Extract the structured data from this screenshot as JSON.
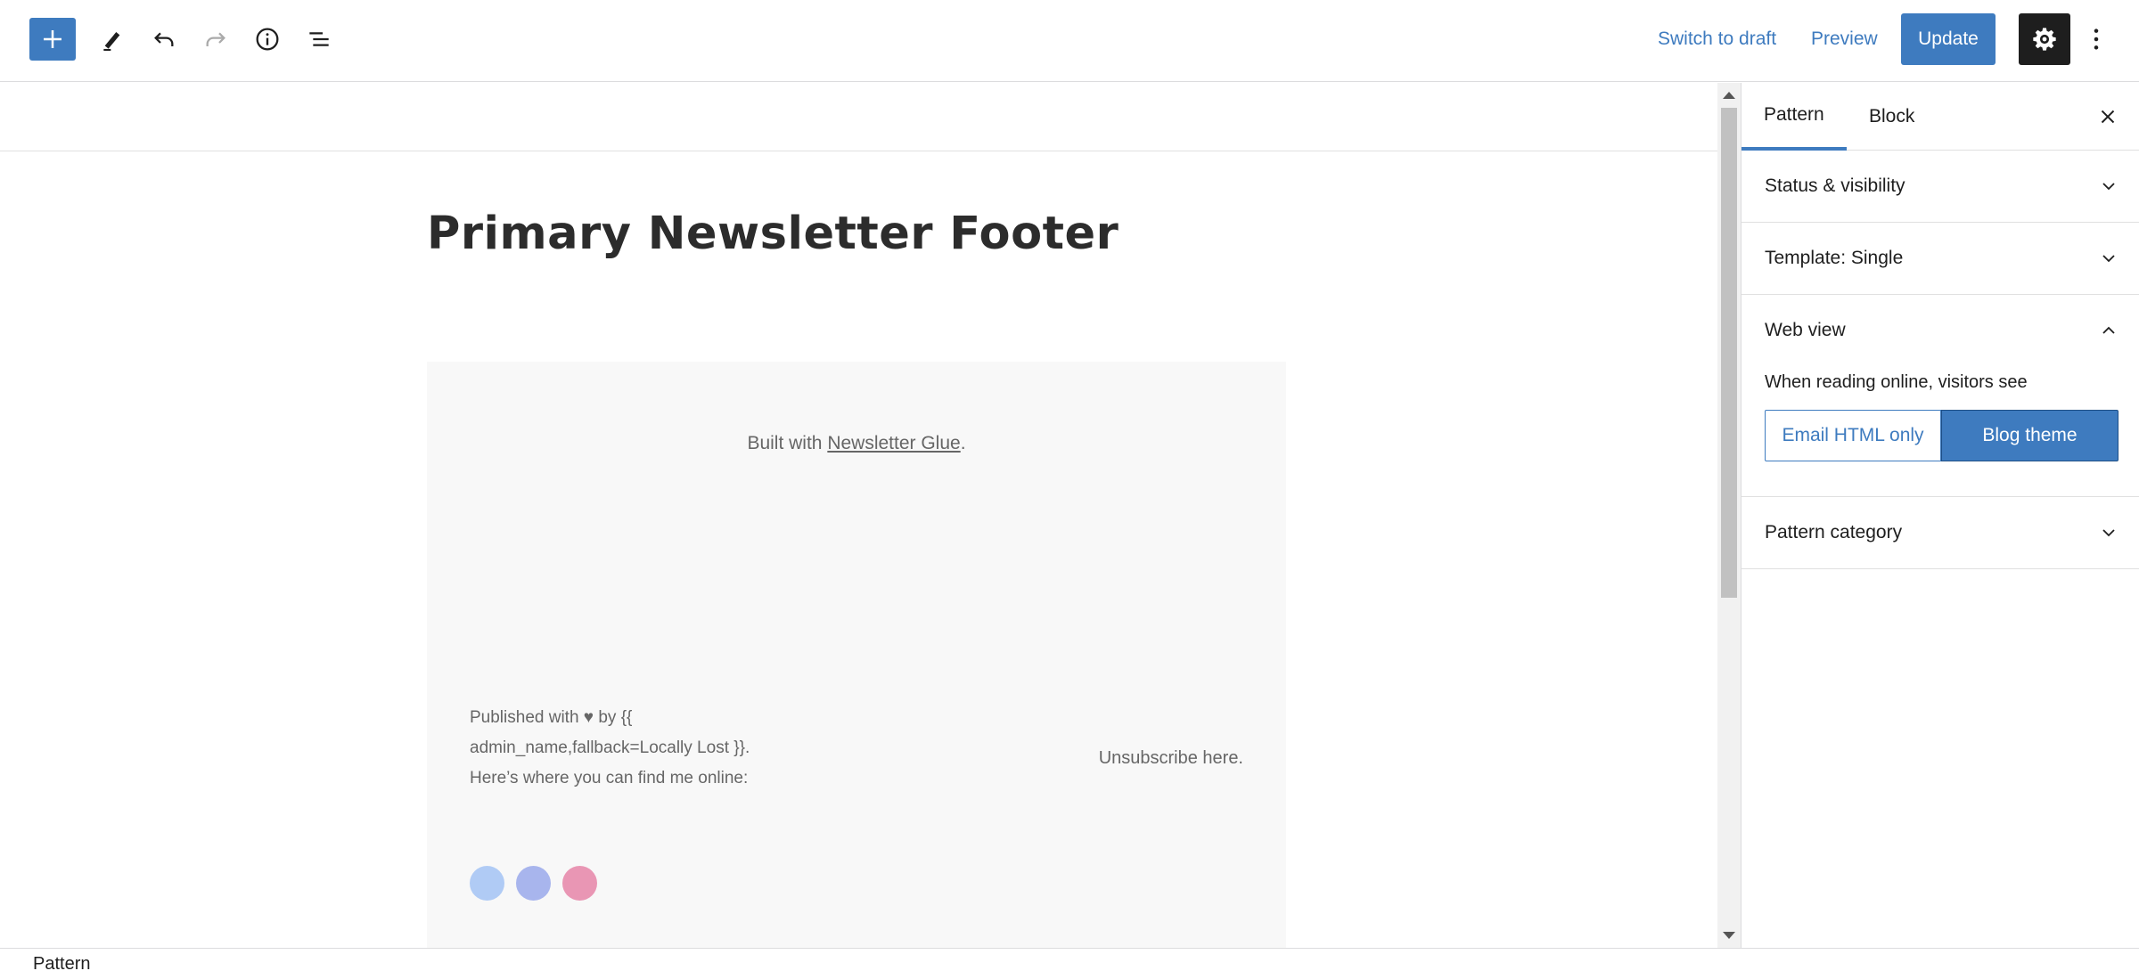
{
  "toolbar": {
    "add_icon": "plus-icon",
    "tools_icon": "pencil-icon",
    "undo_icon": "undo-icon",
    "redo_icon": "redo-icon",
    "details_icon": "info-icon",
    "list_view_icon": "list-view-icon",
    "switch_to_draft": "Switch to draft",
    "preview": "Preview",
    "update": "Update",
    "settings_icon": "gear-icon",
    "more_icon": "more-vertical-icon"
  },
  "editor": {
    "title": "Primary Newsletter Footer",
    "built_with_prefix": "Built with ",
    "built_with_link": "Newsletter Glue",
    "built_with_suffix": ".",
    "published_line1": "Published with ♥ by {{",
    "published_line2": "admin_name,fallback=Locally Lost }}.",
    "published_line3": "Here’s where you can find me online:",
    "unsubscribe": "Unsubscribe here.",
    "social_icons": [
      {
        "name": "social-icon-1",
        "color": "#b0cbf5"
      },
      {
        "name": "social-icon-2",
        "color": "#a8b5ed"
      },
      {
        "name": "social-icon-3",
        "color": "#e996b4"
      }
    ]
  },
  "sidebar": {
    "tabs": [
      "Pattern",
      "Block"
    ],
    "close_icon": "close-icon",
    "panels": {
      "status": "Status & visibility",
      "template": "Template: Single",
      "web_view": "Web view",
      "web_view_desc": "When reading online, visitors see",
      "option_email": "Email HTML only",
      "option_blog": "Blog theme",
      "pattern_category": "Pattern category"
    }
  },
  "footer": {
    "breadcrumb": "Pattern"
  },
  "colors": {
    "accent": "#3e7bbf",
    "dark": "#1e1e1e",
    "block_bg": "#f8f8f8"
  }
}
